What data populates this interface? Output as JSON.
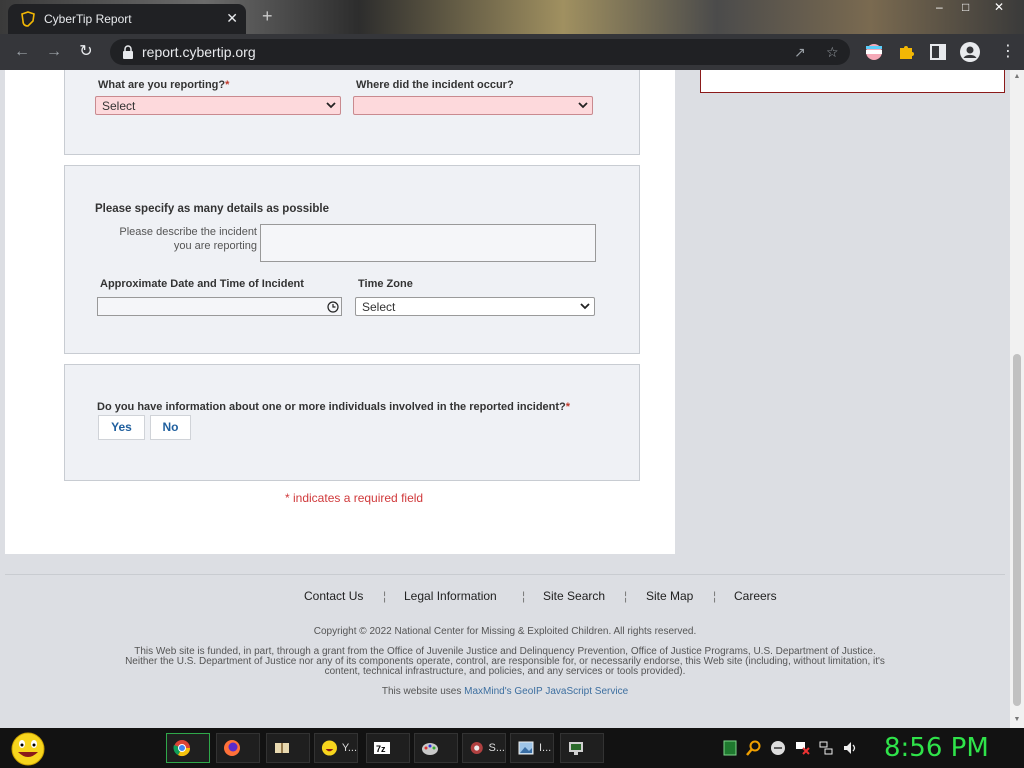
{
  "browser": {
    "tab_title": "CyberTip Report",
    "tab_close": "✕",
    "new_tab": "+",
    "url": "report.cybertip.org",
    "window_controls": {
      "minimize": "–",
      "maximize": "□",
      "close": "✕"
    }
  },
  "form": {
    "section1": {
      "reporting_label": "What are you reporting?",
      "reporting_value": "Select",
      "incident_location_label": "Where did the incident occur?",
      "incident_location_value": ""
    },
    "section2": {
      "heading": "Please specify as many details as possible",
      "describe_label_line1": "Please describe the incident",
      "describe_label_line2": "you are reporting",
      "date_label": "Approximate Date and Time of Incident",
      "timezone_label": "Time Zone",
      "timezone_value": "Select"
    },
    "section3": {
      "question": "Do you have information about one or more individuals involved in the reported incident?",
      "yes_label": "Yes",
      "no_label": "No"
    },
    "required_marker": "*",
    "required_note": "* indicates a required field"
  },
  "footer": {
    "links": [
      "Contact Us",
      "Legal Information",
      "Site Search",
      "Site Map",
      "Careers"
    ],
    "separator": "¦",
    "copyright": "Copyright © 2022 National Center for Missing & Exploited Children. All rights reserved.",
    "funding_line1": "This Web site is funded, in part, through a grant from the Office of Juvenile Justice and Delinquency Prevention, Office of Justice Programs, U.S. Department of Justice.",
    "funding_line2": "Neither the U.S. Department of Justice nor any of its components operate, control, are responsible for, or necessarily endorse, this Web site (including, without limitation, it's",
    "funding_line3": "content, technical infrastructure, and policies, and any services or tools provided).",
    "geoip_prefix": "This website uses",
    "geoip_link": "MaxMind's GeoIP JavaScript Service"
  },
  "taskbar": {
    "items": [
      {
        "label": "",
        "icon": "chrome-icon"
      },
      {
        "label": "",
        "icon": "firefox-icon"
      },
      {
        "label": "",
        "icon": "book-icon"
      },
      {
        "label": "Y...",
        "icon": "emoji-icon"
      },
      {
        "label": "",
        "icon": "7zip-icon"
      },
      {
        "label": "",
        "icon": "paint-icon"
      },
      {
        "label": "S...",
        "icon": "s-app-icon"
      },
      {
        "label": "I...",
        "icon": "image-viewer-icon"
      },
      {
        "label": "",
        "icon": "monitor-icon"
      }
    ],
    "clock": "8:56 PM"
  }
}
